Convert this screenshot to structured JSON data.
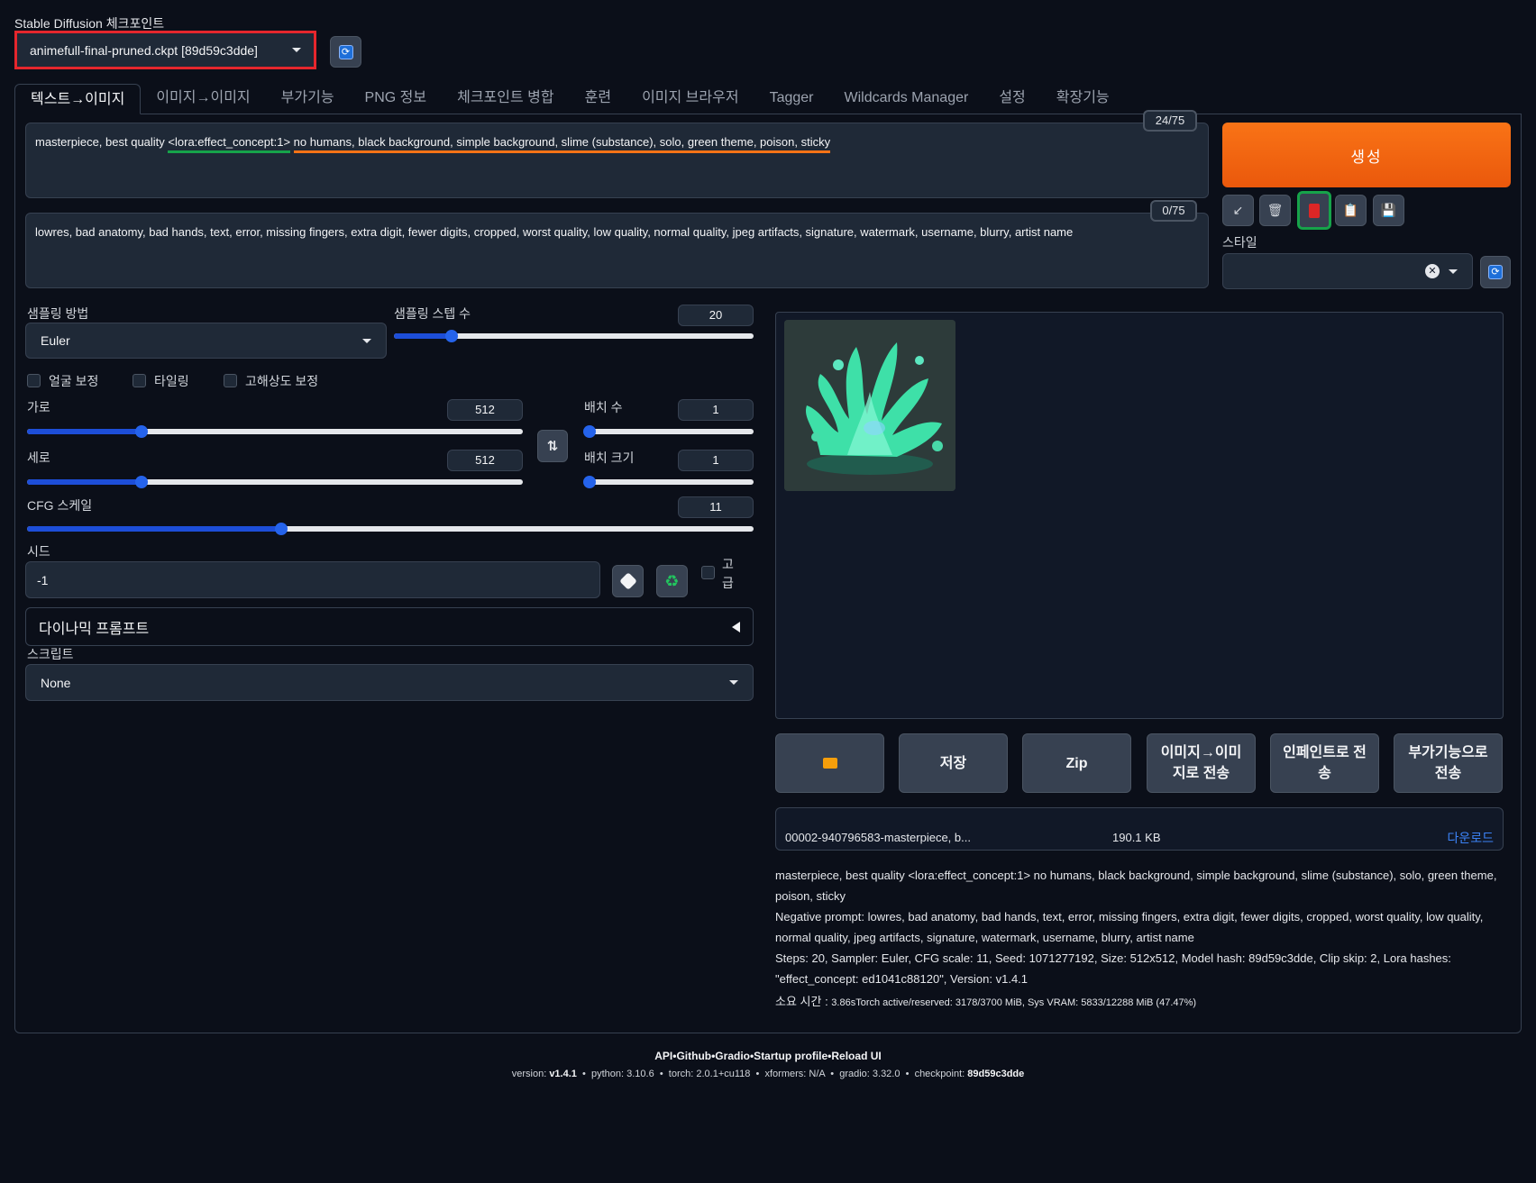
{
  "checkpoint": {
    "label": "Stable Diffusion 체크포인트",
    "value": "animefull-final-pruned.ckpt [89d59c3dde]"
  },
  "tabs": [
    "텍스트→이미지",
    "이미지→이미지",
    "부가기능",
    "PNG 정보",
    "체크포인트 병합",
    "훈련",
    "이미지 브라우저",
    "Tagger",
    "Wildcards Manager",
    "설정",
    "확장기능"
  ],
  "prompt": {
    "part1": "masterpiece, best quality ",
    "lora": "<lora:effect_concept:1>",
    "part2": "no humans, black background, simple background, slime (substance), solo, green theme, poison, sticky",
    "counter": "24/75"
  },
  "negative_prompt": {
    "text": "lowres, bad anatomy, bad hands, text, error, missing fingers, extra digit, fewer digits, cropped, worst quality, low quality, normal quality, jpeg artifacts, signature, watermark, username, blurry, artist name",
    "counter": "0/75"
  },
  "generate_label": "생성",
  "styles_label": "스타일",
  "sampling": {
    "method_label": "샘플링 방법",
    "method": "Euler",
    "steps_label": "샘플링 스텝 수",
    "steps": "20",
    "steps_frac": 0.16
  },
  "checks": {
    "face": "얼굴 보정",
    "tiling": "타일링",
    "hires": "고해상도 보정"
  },
  "width": {
    "label": "가로",
    "value": "512",
    "frac": 0.23
  },
  "height": {
    "label": "세로",
    "value": "512",
    "frac": 0.23
  },
  "batch_count": {
    "label": "배치 수",
    "value": "1",
    "frac": 0.0
  },
  "batch_size": {
    "label": "배치 크기",
    "value": "1",
    "frac": 0.0
  },
  "cfg": {
    "label": "CFG 스케일",
    "value": "11",
    "frac": 0.35
  },
  "seed": {
    "label": "시드",
    "value": "-1",
    "extra_label": "고급"
  },
  "dynamic_prompts": "다이나믹 프롬프트",
  "script": {
    "label": "스크립트",
    "value": "None"
  },
  "actions": [
    "저장",
    "Zip",
    "이미지→이미지로 전송",
    "인페인트로 전송",
    "부가기능으로 전송"
  ],
  "file": {
    "name": "00002-940796583-masterpiece, b...",
    "size": "190.1 KB",
    "download": "다운로드"
  },
  "info": {
    "prompt": "masterpiece, best quality <lora:effect_concept:1> no humans, black background, simple background, slime (substance), solo, green theme, poison, sticky",
    "negative": "Negative prompt: lowres, bad anatomy, bad hands, text, error, missing fingers, extra digit, fewer digits, cropped, worst quality, low quality, normal quality, jpeg artifacts, signature, watermark, username, blurry, artist name",
    "params": "Steps: 20, Sampler: Euler, CFG scale: 11, Seed: 1071277192, Size: 512x512, Model hash: 89d59c3dde, Clip skip: 2, Lora hashes: \"effect_concept: ed1041c88120\", Version: v1.4.1",
    "time_label": "소요 시간 : ",
    "time": "3.86sTorch active/reserved: 3178/3700 MiB, Sys VRAM: 5833/12288 MiB (47.47%)"
  },
  "footer": {
    "links": "API•Github•Gradio•Startup profile•Reload UI",
    "version_label": "version: ",
    "version": "v1.4.1",
    "python": "python: 3.10.6",
    "torch": "torch: 2.0.1+cu118",
    "xformers": "xformers: N/A",
    "gradio": "gradio: 3.32.0",
    "checkpoint_label": "checkpoint: ",
    "checkpoint": "89d59c3dde"
  },
  "colors": {
    "generate": "#f97316",
    "highlight_red": "#e5262d",
    "highlight_green": "#16a34a",
    "slider": "#2563eb"
  }
}
